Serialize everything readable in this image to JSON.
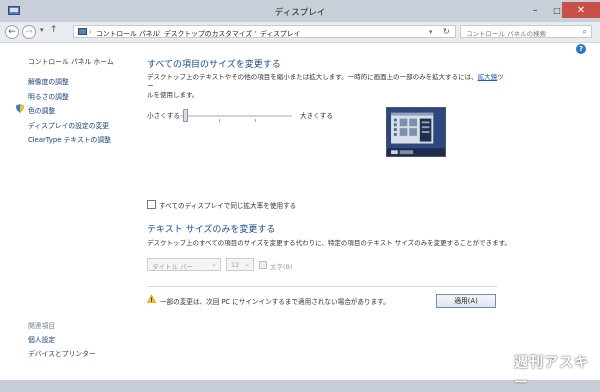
{
  "window": {
    "title": "ディスプレイ",
    "minimize": "–",
    "maximize": "□",
    "close": "✕"
  },
  "nav": {
    "back": "←",
    "forward": "→",
    "recent": "▾",
    "up": "↑",
    "crumbs": [
      "コントロール パネル",
      "デスクトップのカスタマイズ",
      "ディスプレイ"
    ],
    "crumb_sep": "›",
    "address_dropdown": "▾",
    "refresh": "↻",
    "search_placeholder": "コントロール パネルの検索",
    "search_icon": "⌕"
  },
  "sidebar": {
    "home": "コントロール パネル ホーム",
    "items": [
      {
        "label": "解像度の調整"
      },
      {
        "label": "明るさの調整"
      },
      {
        "label": "色の調整",
        "icon": "shield-icon"
      },
      {
        "label": "ディスプレイの設定の変更"
      },
      {
        "label": "ClearType テキストの調整"
      }
    ],
    "related_heading": "関連項目",
    "related": [
      {
        "label": "個人設定"
      },
      {
        "label": "デバイスとプリンター"
      }
    ]
  },
  "main": {
    "help": "?",
    "section1": {
      "heading": "すべての項目のサイズを変更する",
      "desc_before": "デスクトップ上のテキストやその他の項目を縮小または拡大します。一時的に画面上の一部のみを拡大するには、",
      "desc_link": "拡大鏡",
      "desc_after": "ツー",
      "desc_line2": "ルを使用します。",
      "slider_min": "小さくする",
      "slider_max": "大きくする",
      "slider_value": 0
    },
    "same_scale_checkbox": {
      "label": "すべてのディスプレイで同じ拡大率を使用する",
      "checked": false
    },
    "section2": {
      "heading": "テキスト サイズのみを変更する",
      "desc": "デスクトップ上のすべての項目のサイズを変更する代わりに、特定の項目のテキスト サイズのみを変更することができます。",
      "item_select": "タイトル バー",
      "size_select": "12",
      "bold_label": "太字(B)",
      "select_arrow": "⌄"
    },
    "warning": "一部の変更は、次回 PC にサインインするまで適用されない場合があります。",
    "apply_button": "適用(A)"
  },
  "watermark": "週刊アスキー",
  "colors": {
    "accent": "#1a4a8a",
    "link": "#1a3f7a",
    "preview_bg": "#2e4780",
    "close": "#c7504b"
  }
}
